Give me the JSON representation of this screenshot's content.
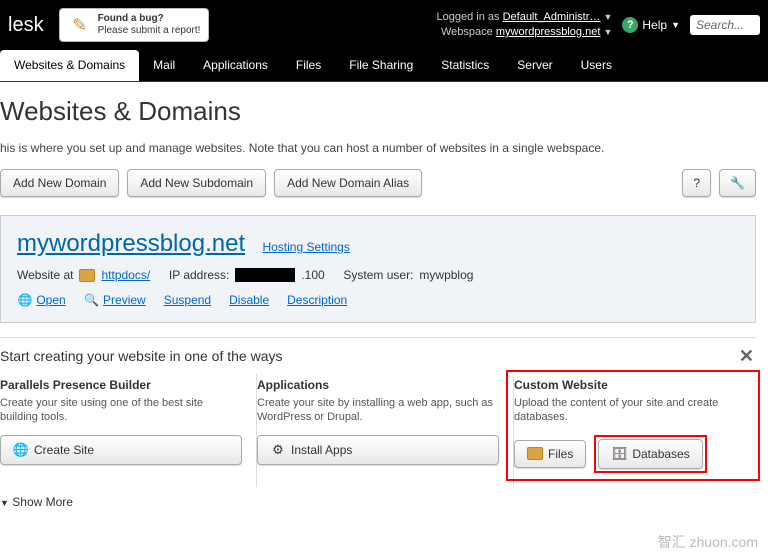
{
  "topbar": {
    "logo": "lesk",
    "bug_title": "Found a bug?",
    "bug_sub": "Please submit a report!",
    "logged_label": "Logged in as",
    "logged_user": "Default_Administr…",
    "webspace_label": "Webspace",
    "webspace_value": "mywordpressblog.net",
    "help": "Help",
    "search_placeholder": "Search..."
  },
  "tabs": [
    "Websites & Domains",
    "Mail",
    "Applications",
    "Files",
    "File Sharing",
    "Statistics",
    "Server",
    "Users"
  ],
  "active_tab": 0,
  "page": {
    "title": "Websites & Domains",
    "desc": "his is where you set up and manage websites. Note that you can host a number of websites in a single webspace."
  },
  "toolbar": {
    "add_domain": "Add New Domain",
    "add_subdomain": "Add New Subdomain",
    "add_alias": "Add New Domain Alias",
    "help_q": "?",
    "wrench": "🔧"
  },
  "domain": {
    "name": "mywordpressblog.net",
    "hosting_settings": "Hosting Settings",
    "website_at": "Website at",
    "httpdocs": "httpdocs/",
    "ip_label": "IP address:",
    "ip_suffix": ".100",
    "sysuser_label": "System user:",
    "sysuser": "mywpblog",
    "open": "Open",
    "preview": "Preview",
    "suspend": "Suspend",
    "disable": "Disable",
    "description": "Description"
  },
  "create": {
    "heading": "Start creating your website in one of the ways",
    "col1_title": "Parallels Presence Builder",
    "col1_desc": "Create your site using one of the best site building tools.",
    "col1_btn": "Create Site",
    "col2_title": "Applications",
    "col2_desc": "Create your site by installing a web app, such as WordPress or Drupal.",
    "col2_btn": "Install Apps",
    "col3_title": "Custom Website",
    "col3_desc": "Upload the content of your site and create databases.",
    "col3_btn1": "Files",
    "col3_btn2": "Databases"
  },
  "showmore": "Show More",
  "watermark": "智汇 zhuon.com"
}
